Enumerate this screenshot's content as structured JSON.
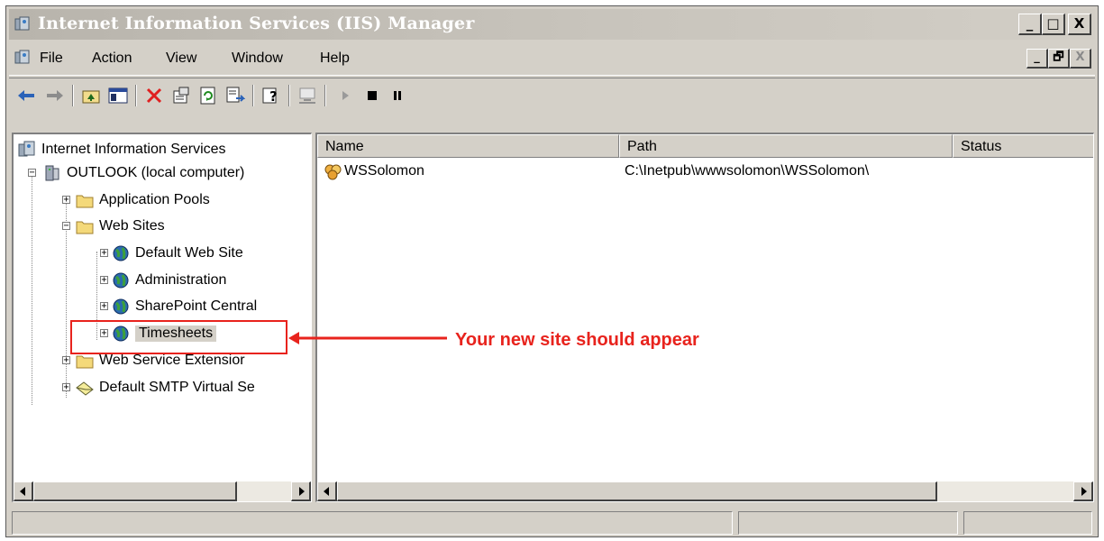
{
  "window": {
    "title": "Internet Information Services (IIS) Manager",
    "caption_buttons": [
      "_",
      "□",
      "X"
    ]
  },
  "menubar": {
    "items": [
      "File",
      "Action",
      "View",
      "Window",
      "Help"
    ],
    "mdi_buttons": [
      "_",
      "🗗",
      "X"
    ]
  },
  "toolbar": {
    "icons": [
      "back-arrow-icon",
      "forward-arrow-icon",
      "up-folder-icon",
      "show-hide-tree-icon",
      "delete-icon",
      "properties-icon",
      "refresh-icon",
      "export-list-icon",
      "help-icon",
      "computer-icon",
      "play-icon",
      "stop-icon",
      "pause-icon"
    ]
  },
  "tree": {
    "root": "Internet Information Services",
    "computer": "OUTLOOK (local computer)",
    "app_pools": "Application Pools",
    "web_sites": "Web Sites",
    "sites": [
      "Default Web Site",
      "Administration",
      "SharePoint Central",
      "Timesheets"
    ],
    "web_service_ext": "Web Service Extensior",
    "smtp": "Default SMTP Virtual Se"
  },
  "list": {
    "columns": [
      "Name",
      "Path",
      "Status"
    ],
    "rows": [
      {
        "name": "WSSolomon",
        "path": "C:\\Inetpub\\wwwsolomon\\WSSolomon\\",
        "status": ""
      }
    ]
  },
  "annotation": {
    "text": "Your new site should appear",
    "color": "#e8231d"
  },
  "colors": {
    "chrome": "#d4d0c8",
    "titlebar_text": "#ffffff"
  }
}
